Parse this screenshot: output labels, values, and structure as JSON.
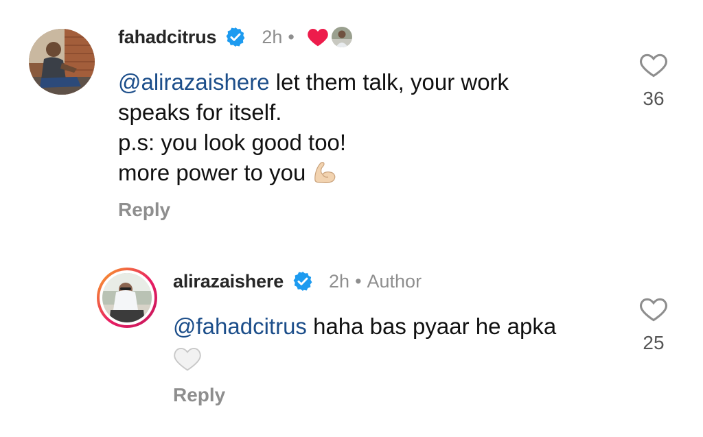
{
  "comments": [
    {
      "username": "fahadcitrus",
      "time": "2h",
      "separator": "•",
      "mention": "@alirazaishere",
      "lines": [
        " let them talk, your work",
        "speaks for itself.",
        "p.s: you look good too!",
        "more power to you"
      ],
      "emoji_icon": "flexed-biceps-icon",
      "reply_label": "Reply",
      "like_count": "36",
      "liked_by_author": true
    },
    {
      "username": "alirazaishere",
      "time": "2h",
      "separator": "•",
      "author_label": "Author",
      "mention": "@fahadcitrus",
      "text_after_mention": " haha bas pyaar he apka",
      "emoji_icon": "white-heart-icon",
      "reply_label": "Reply",
      "like_count": "25"
    }
  ],
  "colors": {
    "mention": "#1c4e8a",
    "muted": "#8e8e8e",
    "verified": "#1d9bf0",
    "liked_heart": "#ed1c4b",
    "story_ring_start": "#f9a825",
    "story_ring_end": "#c2185b"
  }
}
